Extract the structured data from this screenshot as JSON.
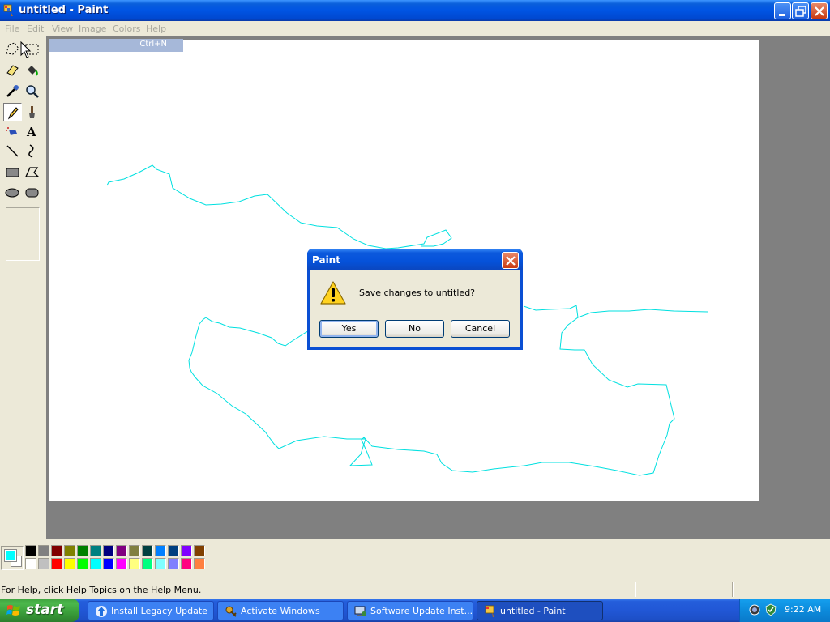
{
  "window": {
    "title": "untitled - Paint",
    "icon": "paint-brush-icon"
  },
  "menu": {
    "items": [
      "File",
      "Edit",
      "View",
      "Image",
      "Colors",
      "Help"
    ],
    "open_item_shortcut": "Ctrl+N"
  },
  "toolbox": {
    "tools": [
      "free-form-select-icon",
      "select-icon",
      "eraser-icon",
      "fill-with-color-icon",
      "pick-color-icon",
      "magnifier-icon",
      "pencil-icon",
      "brush-icon",
      "airbrush-icon",
      "text-icon",
      "line-icon",
      "curve-icon",
      "rectangle-icon",
      "polygon-icon",
      "ellipse-icon",
      "rounded-rectangle-icon"
    ],
    "active_tool": "pencil-icon"
  },
  "palette": {
    "foreground": "#00ffff",
    "background": "#ffffff",
    "colors_top": [
      "#000000",
      "#808080",
      "#800000",
      "#808000",
      "#008000",
      "#008080",
      "#000080",
      "#800080",
      "#808040",
      "#004040",
      "#0080ff",
      "#004080",
      "#8000ff",
      "#804000"
    ],
    "colors_bottom": [
      "#ffffff",
      "#c0c0c0",
      "#ff0000",
      "#ffff00",
      "#00ff00",
      "#00ffff",
      "#0000ff",
      "#ff00ff",
      "#ffff80",
      "#00ff80",
      "#80ffff",
      "#8080ff",
      "#ff0080",
      "#ff8040"
    ]
  },
  "status": {
    "text": "For Help, click Help Topics on the Help Menu."
  },
  "dialog": {
    "title": "Paint",
    "message": "Save changes to untitled?",
    "icon": "warning-icon",
    "buttons": {
      "yes": "Yes",
      "no": "No",
      "cancel": "Cancel"
    }
  },
  "taskbar": {
    "start_label": "start",
    "tasks": [
      {
        "label": "Install Legacy Update",
        "icon": "update-arrow-icon"
      },
      {
        "label": "Activate Windows",
        "icon": "keys-icon"
      },
      {
        "label": "Software Update Inst...",
        "icon": "computer-icon"
      },
      {
        "label": "untitled - Paint",
        "icon": "paint-brush-icon"
      }
    ],
    "clock": "9:22 AM"
  },
  "drawing_color": "#00e0e0"
}
